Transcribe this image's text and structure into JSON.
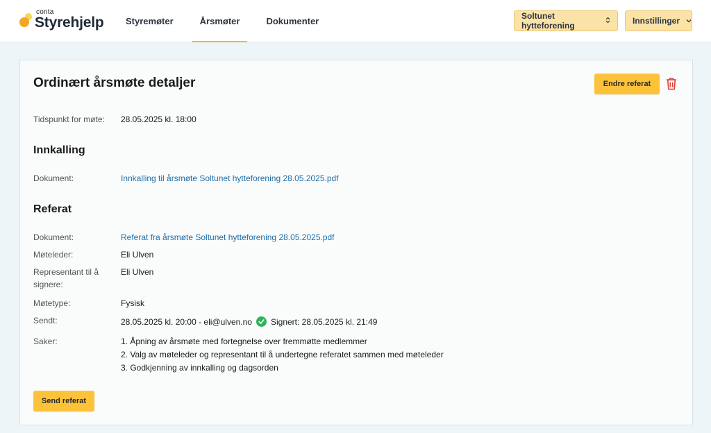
{
  "brand": {
    "small": "conta",
    "name": "Styrehjelp"
  },
  "nav": {
    "items": [
      {
        "label": "Styremøter"
      },
      {
        "label": "Årsmøter"
      },
      {
        "label": "Dokumenter"
      }
    ]
  },
  "org_selector": {
    "value": "Soltunet hytteforening",
    "icon": "chevron-updown-icon"
  },
  "settings_menu": {
    "label": "Innstillinger",
    "icon": "chevron-down-icon"
  },
  "card": {
    "title": "Ordinært årsmøte detaljer",
    "edit_button": "Endre referat",
    "delete_icon": "trash-icon",
    "meeting_time": {
      "label": "Tidspunkt for møte:",
      "value": "28.05.2025 kl. 18:00"
    },
    "innkalling": {
      "title": "Innkalling",
      "document": {
        "label": "Dokument:",
        "value": "Innkalling til årsmøte Soltunet hytteforening 28.05.2025.pdf"
      }
    },
    "referat": {
      "title": "Referat",
      "document": {
        "label": "Dokument:",
        "value": "Referat fra årsmøte Soltunet hytteforening 28.05.2025.pdf"
      },
      "moteleder": {
        "label": "Møteleder:",
        "value": "Eli Ulven"
      },
      "representant": {
        "label": "Representant til å signere:",
        "value": "Eli Ulven"
      },
      "motetype": {
        "label": "Møtetype:",
        "value": "Fysisk"
      },
      "sendt": {
        "label": "Sendt:",
        "value": "28.05.2025 kl. 20:00 - eli@ulven.no",
        "signed_icon": "check-circle-icon",
        "signed": "Signert: 28.05.2025 kl. 21:49"
      },
      "saker": {
        "label": "Saker:",
        "items": [
          "1. Åpning av årsmøte med fortegnelse over fremmøtte medlemmer",
          "2. Valg av møteleder og representant til å undertegne referatet sammen med møteleder",
          "3. Godkjenning av innkalling og dagsorden"
        ]
      }
    },
    "send_button": "Send referat"
  },
  "colors": {
    "accent": "#fcc33a",
    "link": "#1f6fa8",
    "success": "#2fb45a",
    "danger": "#d9413a",
    "background": "#eef5f9"
  }
}
